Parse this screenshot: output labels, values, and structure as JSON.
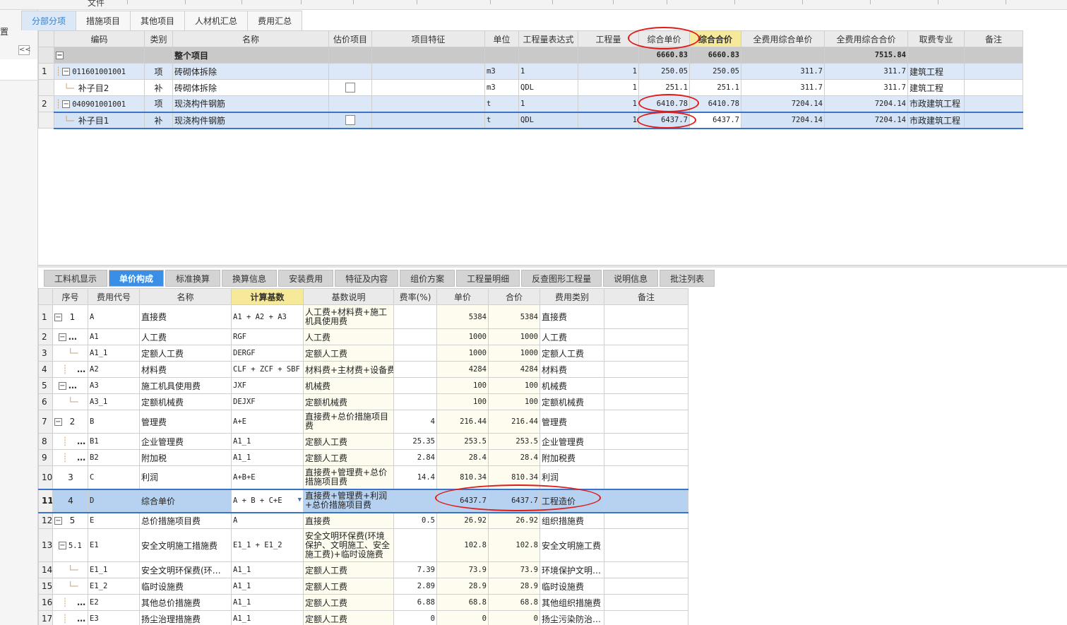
{
  "window": {
    "menu_label": "文件",
    "left_label": "置",
    "collapse_label": "<<"
  },
  "top_tabs": [
    "分部分项",
    "措施项目",
    "其他项目",
    "人材机汇总",
    "费用汇总"
  ],
  "top_table": {
    "columns": [
      "编码",
      "类别",
      "名称",
      "估价项目",
      "项目特征",
      "单位",
      "工程量表达式",
      "工程量",
      "综合单价",
      "综合合价",
      "全费用综合单价",
      "全费用综合合价",
      "取费专业",
      "备注"
    ],
    "total": {
      "name": "整个项目",
      "comp_total": "6660.83",
      "comp_total2": "6660.83",
      "full_total": "7515.84"
    },
    "rows": [
      {
        "no": "1",
        "code": "011601001001",
        "type": "项",
        "name": "砖砌体拆除",
        "unit": "m3",
        "expr": "1",
        "qty": "1",
        "unit_price": "250.05",
        "total": "250.05",
        "full_unit": "311.7",
        "full_total": "311.7",
        "spec": "建筑工程"
      },
      {
        "no": "",
        "code": "补子目2",
        "type": "补",
        "name": "砖砌体拆除",
        "unit": "m3",
        "expr": "QDL",
        "qty": "1",
        "unit_price": "251.1",
        "total": "251.1",
        "full_unit": "311.7",
        "full_total": "311.7",
        "spec": "建筑工程"
      },
      {
        "no": "2",
        "code": "040901001001",
        "type": "项",
        "name": "现浇构件钢筋",
        "unit": "t",
        "expr": "1",
        "qty": "1",
        "unit_price": "6410.78",
        "total": "6410.78",
        "full_unit": "7204.14",
        "full_total": "7204.14",
        "spec": "市政建筑工程"
      },
      {
        "no": "",
        "code": "补子目1",
        "type": "补",
        "name": "现浇构件钢筋",
        "unit": "t",
        "expr": "QDL",
        "qty": "1",
        "unit_price": "6437.7",
        "total": "6437.7",
        "full_unit": "7204.14",
        "full_total": "7204.14",
        "spec": "市政建筑工程"
      }
    ]
  },
  "bottom_tabs": [
    "工料机显示",
    "单价构成",
    "标准换算",
    "换算信息",
    "安装费用",
    "特征及内容",
    "组价方案",
    "工程量明细",
    "反查图形工程量",
    "说明信息",
    "批注列表"
  ],
  "bottom_table": {
    "columns": [
      "序号",
      "费用代号",
      "名称",
      "计算基数",
      "基数说明",
      "费率(%)",
      "单价",
      "合价",
      "费用类别",
      "备注"
    ],
    "rows": [
      {
        "rn": "1",
        "seq": "1",
        "code": "A",
        "name": "直接费",
        "base": "A1 + A2 + A3",
        "desc": "人工费+材料费+施工机具使用费",
        "rate": "",
        "price": "5384",
        "total": "5384",
        "cat": "直接费"
      },
      {
        "rn": "2",
        "seq": "…",
        "code": "A1",
        "name": "人工费",
        "base": "RGF",
        "desc": "人工费",
        "rate": "",
        "price": "1000",
        "total": "1000",
        "cat": "人工费"
      },
      {
        "rn": "3",
        "seq": "",
        "code": "A1_1",
        "name": "定额人工费",
        "base": "DERGF",
        "desc": "定额人工费",
        "rate": "",
        "price": "1000",
        "total": "1000",
        "cat": "定额人工费"
      },
      {
        "rn": "4",
        "seq": "…",
        "code": "A2",
        "name": "材料费",
        "base": "CLF + ZCF + SBF",
        "desc": "材料费+主材费+设备费",
        "rate": "",
        "price": "4284",
        "total": "4284",
        "cat": "材料费"
      },
      {
        "rn": "5",
        "seq": "…",
        "code": "A3",
        "name": "施工机具使用费",
        "base": "JXF",
        "desc": "机械费",
        "rate": "",
        "price": "100",
        "total": "100",
        "cat": "机械费"
      },
      {
        "rn": "6",
        "seq": "",
        "code": "A3_1",
        "name": "定额机械费",
        "base": "DEJXF",
        "desc": "定额机械费",
        "rate": "",
        "price": "100",
        "total": "100",
        "cat": "定额机械费"
      },
      {
        "rn": "7",
        "seq": "2",
        "code": "B",
        "name": "管理费",
        "base": "A+E",
        "desc": "直接费+总价措施项目费",
        "rate": "4",
        "price": "216.44",
        "total": "216.44",
        "cat": "管理费"
      },
      {
        "rn": "8",
        "seq": "…",
        "code": "B1",
        "name": "企业管理费",
        "base": "A1_1",
        "desc": "定额人工费",
        "rate": "25.35",
        "price": "253.5",
        "total": "253.5",
        "cat": "企业管理费"
      },
      {
        "rn": "9",
        "seq": "…",
        "code": "B2",
        "name": "附加税",
        "base": "A1_1",
        "desc": "定额人工费",
        "rate": "2.84",
        "price": "28.4",
        "total": "28.4",
        "cat": "附加税费"
      },
      {
        "rn": "10",
        "seq": "3",
        "code": "C",
        "name": "利润",
        "base": "A+B+E",
        "desc": "直接费+管理费+总价措施项目费",
        "rate": "14.4",
        "price": "810.34",
        "total": "810.34",
        "cat": "利润"
      },
      {
        "rn": "11",
        "seq": "4",
        "code": "D",
        "name": "综合单价",
        "base": "A + B + C+E",
        "desc": "直接费+管理费+利润+总价措施项目费",
        "rate": "",
        "price": "6437.7",
        "total": "6437.7",
        "cat": "工程造价"
      },
      {
        "rn": "12",
        "seq": "5",
        "code": "E",
        "name": "总价措施项目费",
        "base": "A",
        "desc": "直接费",
        "rate": "0.5",
        "price": "26.92",
        "total": "26.92",
        "cat": "组织措施费"
      },
      {
        "rn": "13",
        "seq": "5.1",
        "code": "E1",
        "name": "安全文明施工措施费",
        "base": "E1_1 + E1_2",
        "desc": "安全文明环保费(环境保护、文明施工、安全施工费)+临时设施费",
        "rate": "",
        "price": "102.8",
        "total": "102.8",
        "cat": "安全文明施工费"
      },
      {
        "rn": "14",
        "seq": "",
        "code": "E1_1",
        "name": "安全文明环保费(环…",
        "base": "A1_1",
        "desc": "定额人工费",
        "rate": "7.39",
        "price": "73.9",
        "total": "73.9",
        "cat": "环境保护文明…"
      },
      {
        "rn": "15",
        "seq": "",
        "code": "E1_2",
        "name": "临时设施费",
        "base": "A1_1",
        "desc": "定额人工费",
        "rate": "2.89",
        "price": "28.9",
        "total": "28.9",
        "cat": "临时设施费"
      },
      {
        "rn": "16",
        "seq": "…",
        "code": "E2",
        "name": "其他总价措施费",
        "base": "A1_1",
        "desc": "定额人工费",
        "rate": "6.88",
        "price": "68.8",
        "total": "68.8",
        "cat": "其他组织措施费"
      },
      {
        "rn": "17",
        "seq": "…",
        "code": "E3",
        "name": "扬尘治理措施费",
        "base": "A1_1",
        "desc": "定额人工费",
        "rate": "0",
        "price": "0",
        "total": "0",
        "cat": "扬尘污染防治…"
      }
    ]
  },
  "colors": {
    "accent": "#3a8ee6",
    "highlight_header": "#f6e99a",
    "selection": "#3b74c7",
    "annotation": "#e01b1b"
  }
}
